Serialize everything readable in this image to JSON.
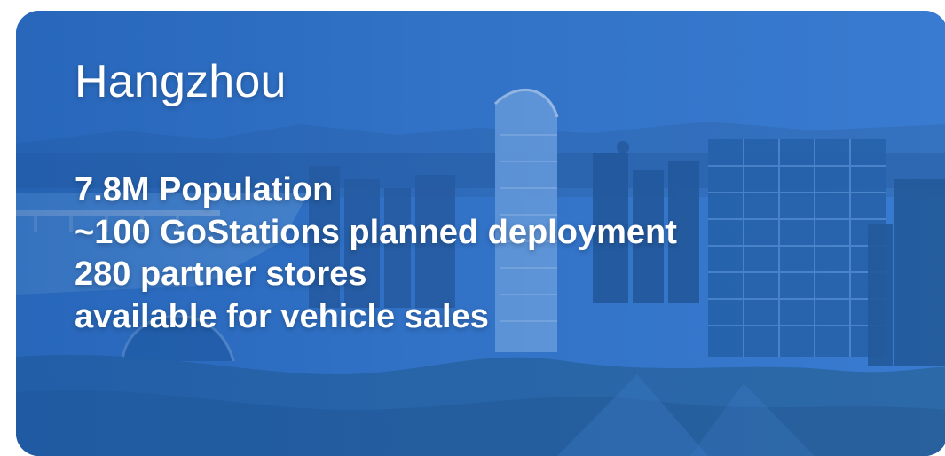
{
  "card": {
    "city": "Hangzhou",
    "lines": [
      "7.8M Population",
      "~100 GoStations planned deployment",
      "280 partner stores",
      "available for vehicle sales"
    ]
  },
  "colors": {
    "sky": "#3b7fd6",
    "water": "#6aa6e6",
    "foliage": "#2f6ca6",
    "text": "#ffffff"
  }
}
